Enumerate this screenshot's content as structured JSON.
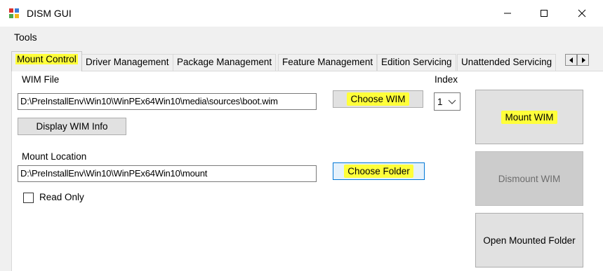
{
  "window": {
    "title": "DISM GUI"
  },
  "menu": {
    "items": [
      "Tools"
    ]
  },
  "tabs": [
    {
      "label": "Mount Control",
      "active": true,
      "highlighted": true
    },
    {
      "label": "Driver Management",
      "active": false
    },
    {
      "label": "Package Management",
      "active": false
    },
    {
      "label": "Feature Management",
      "active": false
    },
    {
      "label": "Edition Servicing",
      "active": false
    },
    {
      "label": "Unattended Servicing",
      "active": false
    }
  ],
  "tab_scroll": {
    "left": "◂",
    "right": "▸"
  },
  "mount_control": {
    "wim_file_label": "WIM File",
    "wim_file_value": "D:\\PreInstallEnv\\Win10\\WinPEx64Win10\\media\\sources\\boot.wim",
    "choose_wim_label": "Choose WIM",
    "display_wim_info_label": "Display WIM Info",
    "index_label": "Index",
    "index_value": "1",
    "mount_location_label": "Mount Location",
    "mount_location_value": "D:\\PreInstallEnv\\Win10\\WinPEx64Win10\\mount",
    "choose_folder_label": "Choose Folder",
    "read_only_label": "Read Only",
    "read_only_checked": false,
    "mount_wim_label": "Mount WIM",
    "dismount_wim_label": "Dismount WIM",
    "open_mounted_folder_label": "Open Mounted Folder"
  },
  "colors": {
    "highlight": "#ffff3a",
    "window_bg": "#f0f0f0",
    "focus_border": "#0078d7",
    "disabled_button": "#cccccc"
  }
}
